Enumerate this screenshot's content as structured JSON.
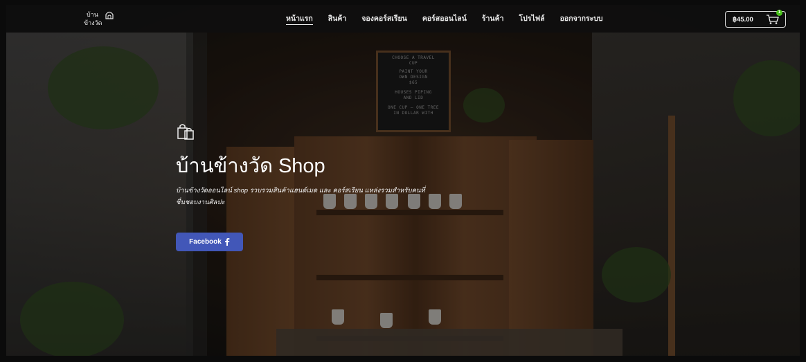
{
  "logo": {
    "line1": "บ้าน",
    "line2": "ข้างวัด",
    "icon": "house-icon"
  },
  "nav": {
    "items": [
      {
        "label": "หน้าแรก",
        "active": true
      },
      {
        "label": "สินค้า",
        "active": false
      },
      {
        "label": "จองคอร์สเรียน",
        "active": false
      },
      {
        "label": "คอร์สออนไลน์",
        "active": false
      },
      {
        "label": "ร้านค้า",
        "active": false
      },
      {
        "label": "โปรไฟล์",
        "active": false
      },
      {
        "label": "ออกจากระบบ",
        "active": false
      }
    ],
    "cart": {
      "total": "฿45.00",
      "count": "1",
      "icon": "cart-icon"
    }
  },
  "hero": {
    "icon": "shopping-bags-icon",
    "title": "บ้านข้างวัด Shop",
    "description": "บ้านข้างวัดออนไลน์ shop รวบรวมสินค้าแฮนด์เมด และ คอร์สเรียน แหล่งรวมสำหรับคนที่ชื่นชอบงานศิลปะ",
    "facebook_label": "Facebook",
    "facebook_icon": "facebook-icon"
  },
  "scene": {
    "board_lines": [
      "CHOOSE A TRAVEL",
      "CUP",
      "PAINT YOUR",
      "OWN DESIGN",
      "$65",
      "HOUSES PIPING",
      "AND LID",
      "ONE CUP — ONE TREE",
      "IN DOLLAR WITH"
    ]
  },
  "colors": {
    "accent": "#4257b8",
    "badge": "#49c21a",
    "nav_bg": "#0f0f0f"
  }
}
